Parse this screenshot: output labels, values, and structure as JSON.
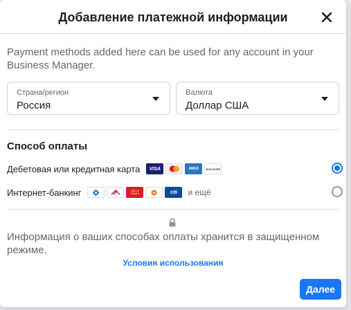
{
  "dialog": {
    "title": "Добавление платежной информации",
    "close_label": "Закрыть"
  },
  "info_text": "Payment methods added here can be used for any account in your Business Manager.",
  "country": {
    "label": "Страна/регион",
    "value": "Россия"
  },
  "currency": {
    "label": "Валюта",
    "value": "Доллар США"
  },
  "payment": {
    "section_title": "Способ оплаты",
    "options": [
      {
        "label": "Дебетовая или кредитная карта",
        "selected": true,
        "icons": [
          "visa-icon",
          "mastercard-icon",
          "amex-icon",
          "discover-icon"
        ]
      },
      {
        "label": "Интернет-банкинг",
        "selected": false,
        "more": "и ещё",
        "icons": [
          "chase-icon",
          "bofa-icon",
          "wells-fargo-icon",
          "pnc-icon",
          "citi-icon"
        ]
      }
    ]
  },
  "card_texts": {
    "visa": "VISA",
    "amex": "AMEX",
    "discover": "DISCOVER",
    "wells": "WELLS FARGO",
    "citi": "citi"
  },
  "secure_text": "Информация о ваших способах оплаты хранится в защищенном режиме.",
  "terms_link": "Условия использования",
  "next_button": "Далее",
  "colors": {
    "accent": "#1877f2",
    "text": "#1c1e21",
    "secondary_text": "#606770",
    "border": "#ccd0d5"
  }
}
